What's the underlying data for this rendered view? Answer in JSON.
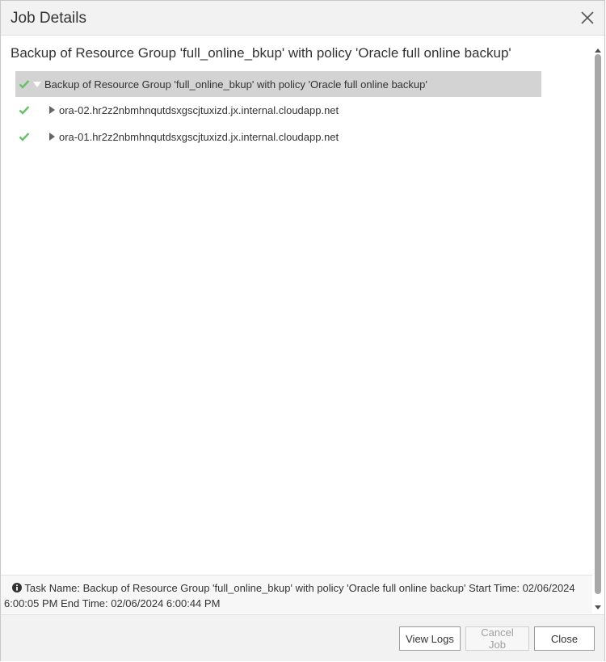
{
  "window": {
    "title": "Job Details",
    "close_icon": "close-icon"
  },
  "main": {
    "heading": "Backup of Resource Group 'full_online_bkup' with policy 'Oracle full online backup'",
    "tree": {
      "root": {
        "label": "Backup of Resource Group 'full_online_bkup' with policy 'Oracle full online backup'",
        "status": "success",
        "expanded": true
      },
      "children": [
        {
          "label": "ora-02.hr2z2nbmhnqutdsxgscjtuxizd.jx.internal.cloudapp.net",
          "status": "success",
          "expanded": false
        },
        {
          "label": "ora-01.hr2z2nbmhnqutdsxgscjtuxizd.jx.internal.cloudapp.net",
          "status": "success",
          "expanded": false
        }
      ]
    }
  },
  "info": {
    "text": "Task Name: Backup of Resource Group 'full_online_bkup' with policy 'Oracle full online backup' Start Time: 02/06/2024 6:00:05 PM End Time: 02/06/2024 6:00:44 PM"
  },
  "footer": {
    "view_logs": "View Logs",
    "cancel_job": "Cancel Job",
    "close": "Close"
  },
  "colors": {
    "success": "#6abf69",
    "selected_row": "#d3d3d3"
  }
}
